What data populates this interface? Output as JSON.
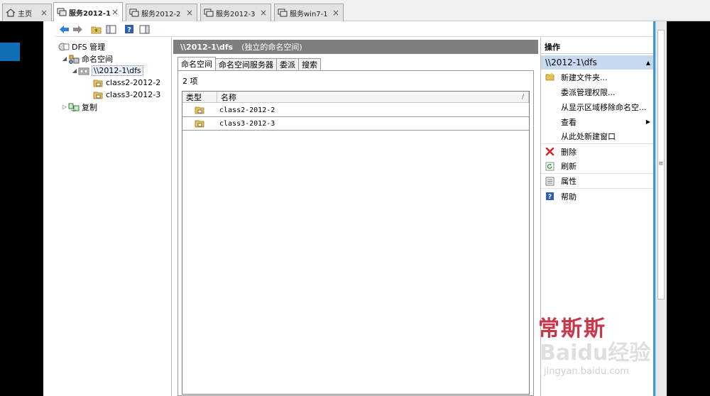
{
  "browser_tabs": [
    {
      "label": "主页",
      "icon": "home-icon",
      "active": false
    },
    {
      "label": "服务2012-1",
      "icon": "vm-icon",
      "active": true
    },
    {
      "label": "服务2012-2",
      "icon": "vm-icon",
      "active": false
    },
    {
      "label": "服务2012-3",
      "icon": "vm-icon",
      "active": false
    },
    {
      "label": "服务win7-1",
      "icon": "vm-icon",
      "active": false
    }
  ],
  "tab_close_glyph": "×",
  "tree": {
    "root": "DFS 管理",
    "namespaces": "命名空间",
    "selected_namespace": "\\\\2012-1\\dfs",
    "folders": [
      "class2-2012-2",
      "class3-2012-3"
    ],
    "replication": "复制"
  },
  "center": {
    "header_path": "\\\\2012-1\\dfs",
    "header_desc": "(独立的命名空间)",
    "tabs": [
      "命名空间",
      "命名空间服务器",
      "委派",
      "搜索"
    ],
    "count_text": "2 项",
    "columns": [
      "类型",
      "名称"
    ],
    "rows": [
      {
        "name": "class2-2012-2"
      },
      {
        "name": "class3-2012-3"
      }
    ]
  },
  "actions": {
    "title": "操作",
    "section": "\\\\2012-1\\dfs",
    "items": [
      {
        "label": "新建文件夹...",
        "icon": "new-folder-icon"
      },
      {
        "label": "委派管理权限...",
        "icon": ""
      },
      {
        "label": "从显示区域移除命名空...",
        "icon": ""
      },
      {
        "label": "查看",
        "icon": "",
        "submenu": true
      },
      {
        "label": "从此处新建窗口",
        "icon": ""
      },
      {
        "label": "删除",
        "icon": "delete-icon"
      },
      {
        "label": "刷新",
        "icon": "refresh-icon"
      },
      {
        "label": "属性",
        "icon": "properties-icon"
      },
      {
        "label": "帮助",
        "icon": "help-icon"
      }
    ]
  },
  "watermark": {
    "top": "常斯斯",
    "mid": "Baidu经验",
    "url": "jingyan.baidu.com"
  },
  "colors": {
    "header_gray": "#7f7f7f",
    "section_blue": "#c7d9ef",
    "accent_blue": "#0f6fb7",
    "delete_red": "#d6242a"
  }
}
